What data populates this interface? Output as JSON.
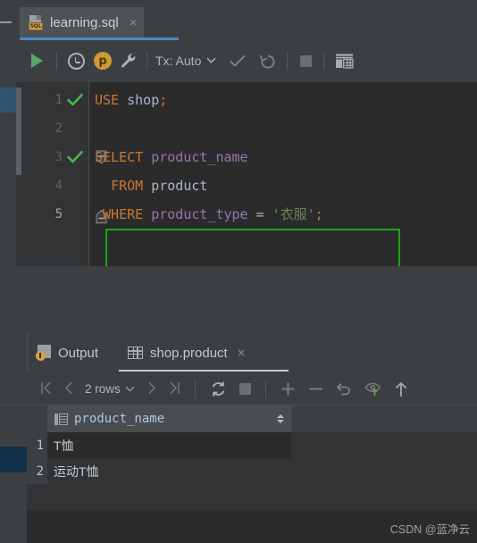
{
  "window": {
    "app": "DataGrip SQL editor"
  },
  "editor_tab": {
    "icon": "sql-file-icon",
    "badge": "SQL",
    "title": "learning.sql",
    "close": "×"
  },
  "editor_toolbar": {
    "run": "run-icon",
    "history": "history-clock-icon",
    "profile": "profile-p-icon",
    "settings": "wrench-icon",
    "tx_label": "Tx: Auto",
    "tx_chevron": "⌄",
    "commit": "commit-check-icon",
    "rollback": "rollback-icon",
    "stop": "stop-icon",
    "console": "console-grid-icon"
  },
  "code": {
    "lines": [
      {
        "num": "1",
        "status": "ok",
        "tokens": [
          {
            "t": "USE",
            "c": "kw"
          },
          {
            "t": " ",
            "c": "op"
          },
          {
            "t": "shop",
            "c": "id"
          },
          {
            "t": ";",
            "c": "kw"
          }
        ]
      },
      {
        "num": "2",
        "status": "",
        "tokens": []
      },
      {
        "num": "3",
        "status": "ok",
        "tokens": [
          {
            "t": "SELECT",
            "c": "kw"
          },
          {
            "t": " ",
            "c": "op"
          },
          {
            "t": "product_name",
            "c": "col"
          }
        ]
      },
      {
        "num": "4",
        "status": "",
        "tokens": [
          {
            "t": "  ",
            "c": "op"
          },
          {
            "t": "FROM",
            "c": "kw"
          },
          {
            "t": " ",
            "c": "op"
          },
          {
            "t": "product",
            "c": "id"
          }
        ]
      },
      {
        "num": "5",
        "status": "",
        "tokens": [
          {
            "t": " ",
            "c": "op"
          },
          {
            "t": "WHERE",
            "c": "kw"
          },
          {
            "t": " ",
            "c": "op"
          },
          {
            "t": "product_type",
            "c": "col"
          },
          {
            "t": " = ",
            "c": "op"
          },
          {
            "t": "'衣服'",
            "c": "str"
          },
          {
            "t": ";",
            "c": "kw"
          }
        ]
      }
    ]
  },
  "results_tabs": [
    {
      "label": "Output",
      "icon": "output-icon",
      "active": false,
      "closable": false
    },
    {
      "label": "shop.product",
      "icon": "table-grid-icon",
      "active": true,
      "closable": true,
      "close": "×"
    }
  ],
  "results_toolbar": {
    "first": "⧏|",
    "prev": "‹",
    "rows_label": "2 rows",
    "rows_chevron": "⌄",
    "next": "›",
    "last": "|⧐",
    "reload": "refresh-icon",
    "stop": "stop-icon",
    "add_row": "+",
    "remove_row": "−",
    "revert": "revert-icon",
    "view_value": "view-value-icon",
    "submit": "submit-up-icon"
  },
  "result_grid": {
    "columns": [
      {
        "name": "product_name",
        "icon": "column-icon",
        "sort": "sort-arrows-icon"
      }
    ],
    "rows": [
      {
        "num": "1",
        "values": [
          "T恤"
        ]
      },
      {
        "num": "2",
        "values": [
          "运动T恤"
        ]
      }
    ]
  },
  "watermark": {
    "text": "CSDN @蓝净云"
  },
  "colors": {
    "accent_blue": "#4a88c7",
    "run_green": "#59a869",
    "selection_green": "#17a817",
    "keyword_orange": "#cc7832",
    "column_purple": "#9876aa",
    "string_green": "#6a8759",
    "badge_orange": "#d6a342"
  }
}
